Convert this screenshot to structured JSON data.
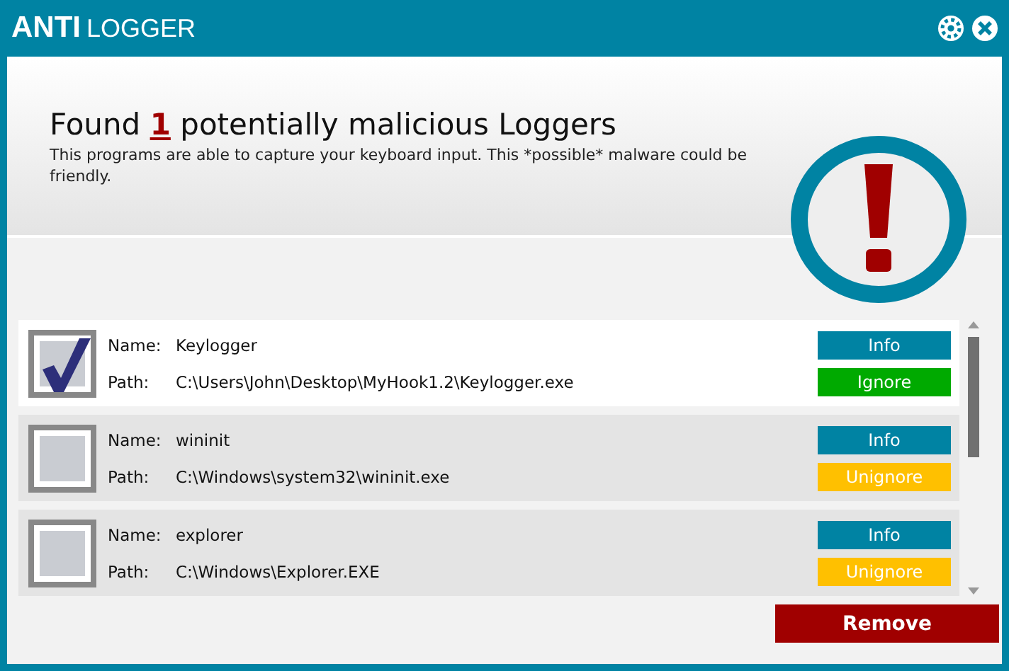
{
  "window": {
    "title_bold": "ANTI",
    "title": "LOGGER"
  },
  "header": {
    "headline": "Found **1** potentially malicious Loggers",
    "description": "This programs are able to capture your keyboard input. This *possible* malware could be friendly."
  },
  "items": [
    {
      "selected": true,
      "checked": true,
      "name_label": "Name:",
      "name": "Keylogger",
      "path_label": "Path:",
      "path": "C:\\Users\\John\\Desktop\\MyHook1.2\\Keylogger.exe",
      "info_button": "Info",
      "ignore_button": "Ignore",
      "ignored": false
    },
    {
      "selected": false,
      "checked": false,
      "name_label": "Name:",
      "name": "wininit",
      "path_label": "Path:",
      "path": "C:\\Windows\\system32\\wininit.exe",
      "info_button": "Info",
      "ignore_button": "Unignore",
      "ignored": true
    },
    {
      "selected": false,
      "checked": false,
      "name_label": "Name:",
      "name": "explorer",
      "path_label": "Path:",
      "path": "C:\\Windows\\Explorer.EXE",
      "info_button": "Info",
      "ignore_button": "Unignore",
      "ignored": true
    }
  ],
  "remove_button": "Remove"
}
